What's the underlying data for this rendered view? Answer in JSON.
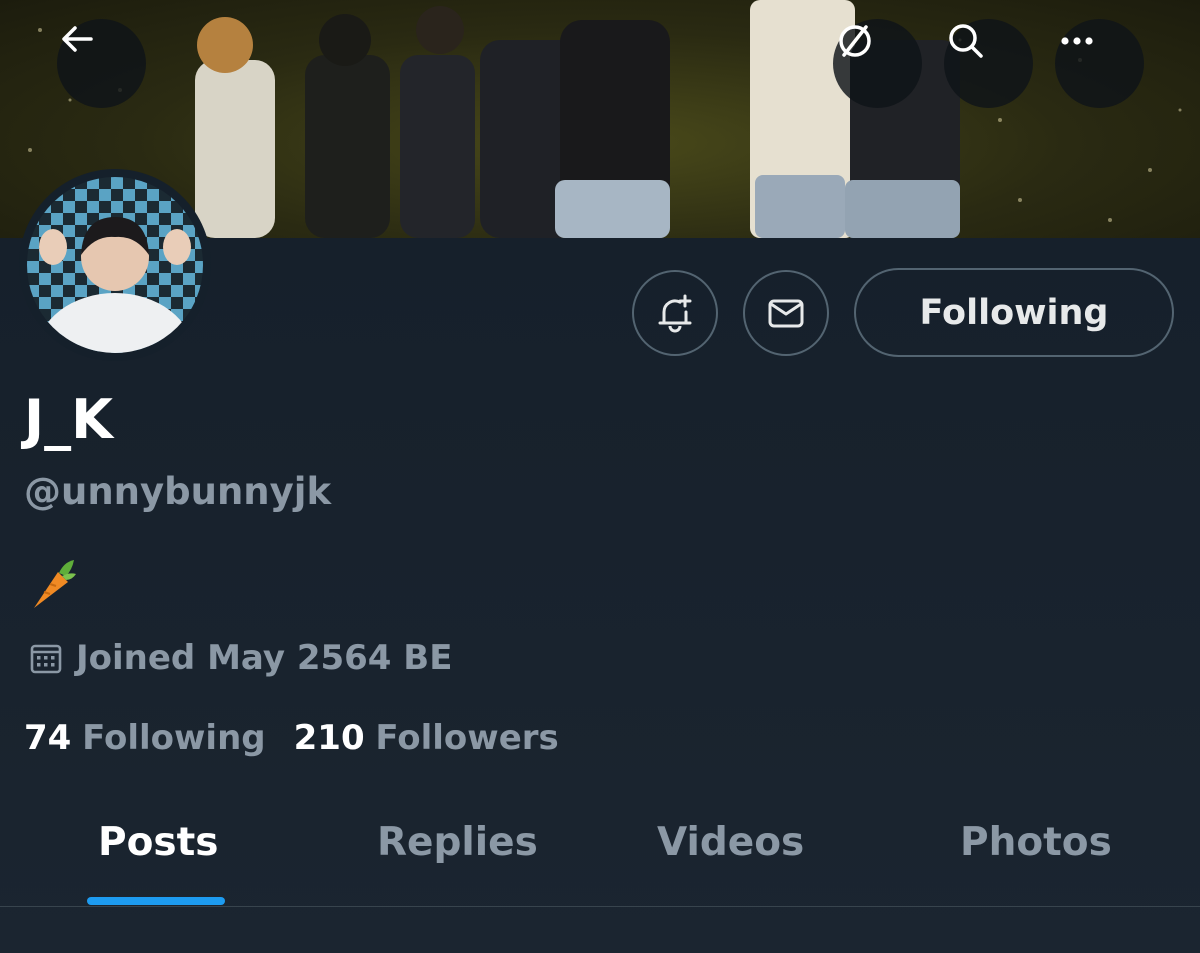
{
  "header": {
    "back_icon": "arrow-left-icon",
    "mute_icon": "no-sign-icon",
    "search_icon": "search-icon",
    "more_icon": "more-horizontal-icon"
  },
  "profile": {
    "display_name": "J_K",
    "handle": "@unnybunnyjk",
    "bio": "🥕",
    "joined": "Joined May 2564 BE",
    "following_count": "74",
    "following_label": "Following",
    "followers_count": "210",
    "followers_label": "Followers"
  },
  "actions": {
    "notify_icon": "bell-plus-icon",
    "message_icon": "mail-icon",
    "follow_label": "Following"
  },
  "tabs": [
    {
      "label": "Posts",
      "active": true
    },
    {
      "label": "Replies",
      "active": false
    },
    {
      "label": "Videos",
      "active": false
    },
    {
      "label": "Photos",
      "active": false
    }
  ],
  "colors": {
    "background": "#15202b",
    "accent": "#1d9bf0",
    "muted_text": "#8b98a5",
    "border": "#536471"
  }
}
